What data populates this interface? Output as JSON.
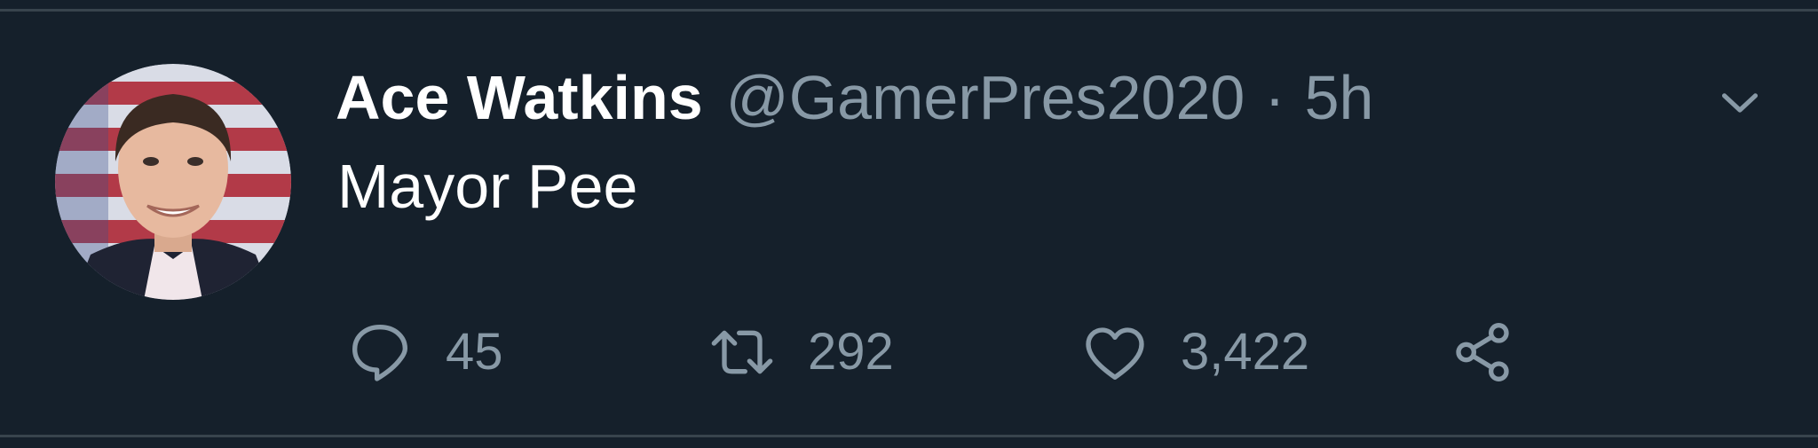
{
  "tweet": {
    "author": {
      "display_name": "Ace Watkins",
      "handle": "@GamerPres2020",
      "avatar_icon": "profile-photo"
    },
    "separator": "·",
    "time": "5h",
    "text": "Mayor Pee",
    "more_menu_icon": "chevron-down-icon",
    "actions": {
      "reply": {
        "icon": "reply-bubble-icon",
        "count": "45"
      },
      "retweet": {
        "icon": "retweet-icon",
        "count": "292"
      },
      "like": {
        "icon": "heart-icon",
        "count": "3,422"
      },
      "share": {
        "icon": "share-icon"
      }
    }
  },
  "colors": {
    "background": "#15202b",
    "divider": "#38444d",
    "primary_text": "#ffffff",
    "secondary_text": "#8899a6"
  }
}
